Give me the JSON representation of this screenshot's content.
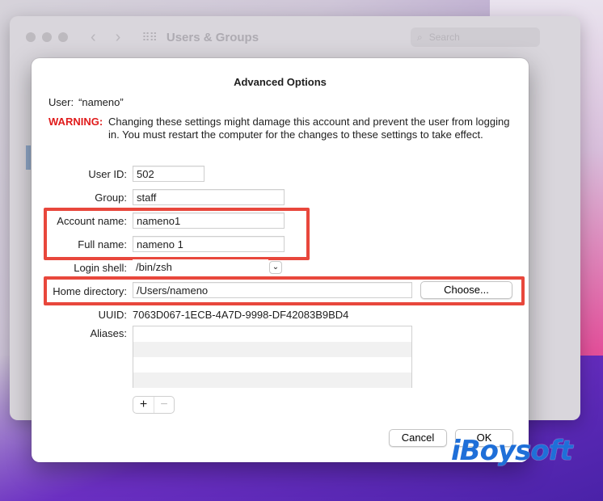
{
  "background_window": {
    "title": "Users & Groups",
    "search_placeholder": "Search"
  },
  "dialog": {
    "title": "Advanced Options",
    "user_label": "User:",
    "user_value": "“nameno”",
    "warning_label": "WARNING:",
    "warning_text": "Changing these settings might damage this account and prevent the user from logging in. You must restart the computer for the changes to these settings to take effect.",
    "fields": {
      "user_id": {
        "label": "User ID:",
        "value": "502"
      },
      "group": {
        "label": "Group:",
        "value": "staff"
      },
      "account_name": {
        "label": "Account name:",
        "value": "nameno1"
      },
      "full_name": {
        "label": "Full name:",
        "value": "nameno 1"
      },
      "login_shell": {
        "label": "Login shell:",
        "value": "/bin/zsh"
      },
      "home_directory": {
        "label": "Home directory:",
        "value": "/Users/nameno"
      },
      "uuid": {
        "label": "UUID:",
        "value": "7063D067-1ECB-4A7D-9998-DF42083B9BD4"
      },
      "aliases": {
        "label": "Aliases:"
      }
    },
    "buttons": {
      "choose": "Choose...",
      "add": "+",
      "remove": "−",
      "cancel": "Cancel",
      "ok": "OK"
    }
  },
  "watermark": "iBoysoft",
  "colors": {
    "highlight": "#e8473c",
    "warning": "#e01b1b",
    "watermark": "#1f6fd8"
  }
}
